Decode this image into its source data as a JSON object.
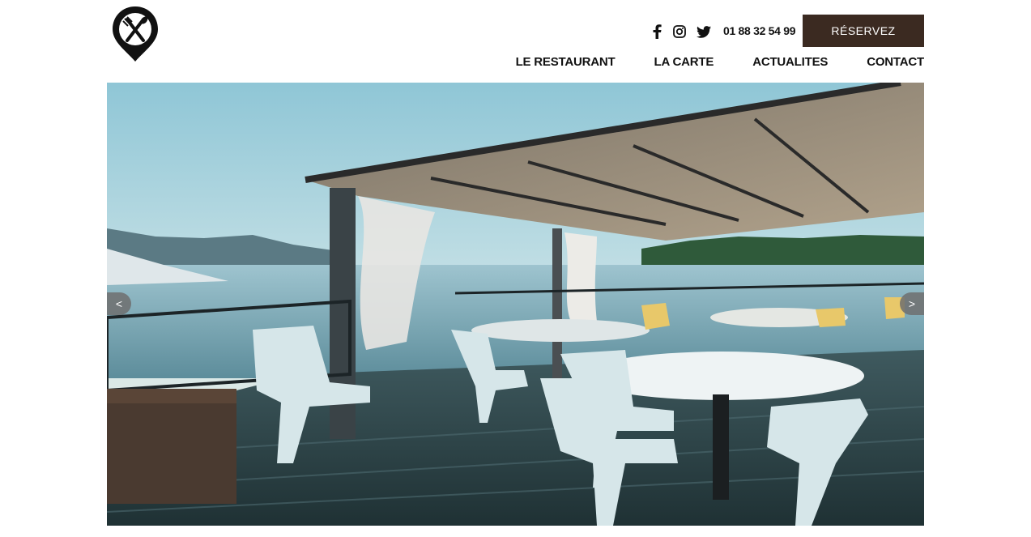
{
  "header": {
    "phone": "01 88 32 54 99",
    "reserve_label": "RÉSERVEZ",
    "social": [
      {
        "icon": "facebook-icon"
      },
      {
        "icon": "instagram-icon"
      },
      {
        "icon": "twitter-icon"
      }
    ]
  },
  "nav": {
    "items": [
      {
        "label": "LE RESTAURANT"
      },
      {
        "label": "LA CARTE"
      },
      {
        "label": "ACTUALITES"
      },
      {
        "label": "CONTACT"
      }
    ]
  },
  "slider": {
    "prev_label": "<",
    "next_label": ">"
  },
  "colors": {
    "brand": "#3b2a21",
    "text": "#111111"
  }
}
